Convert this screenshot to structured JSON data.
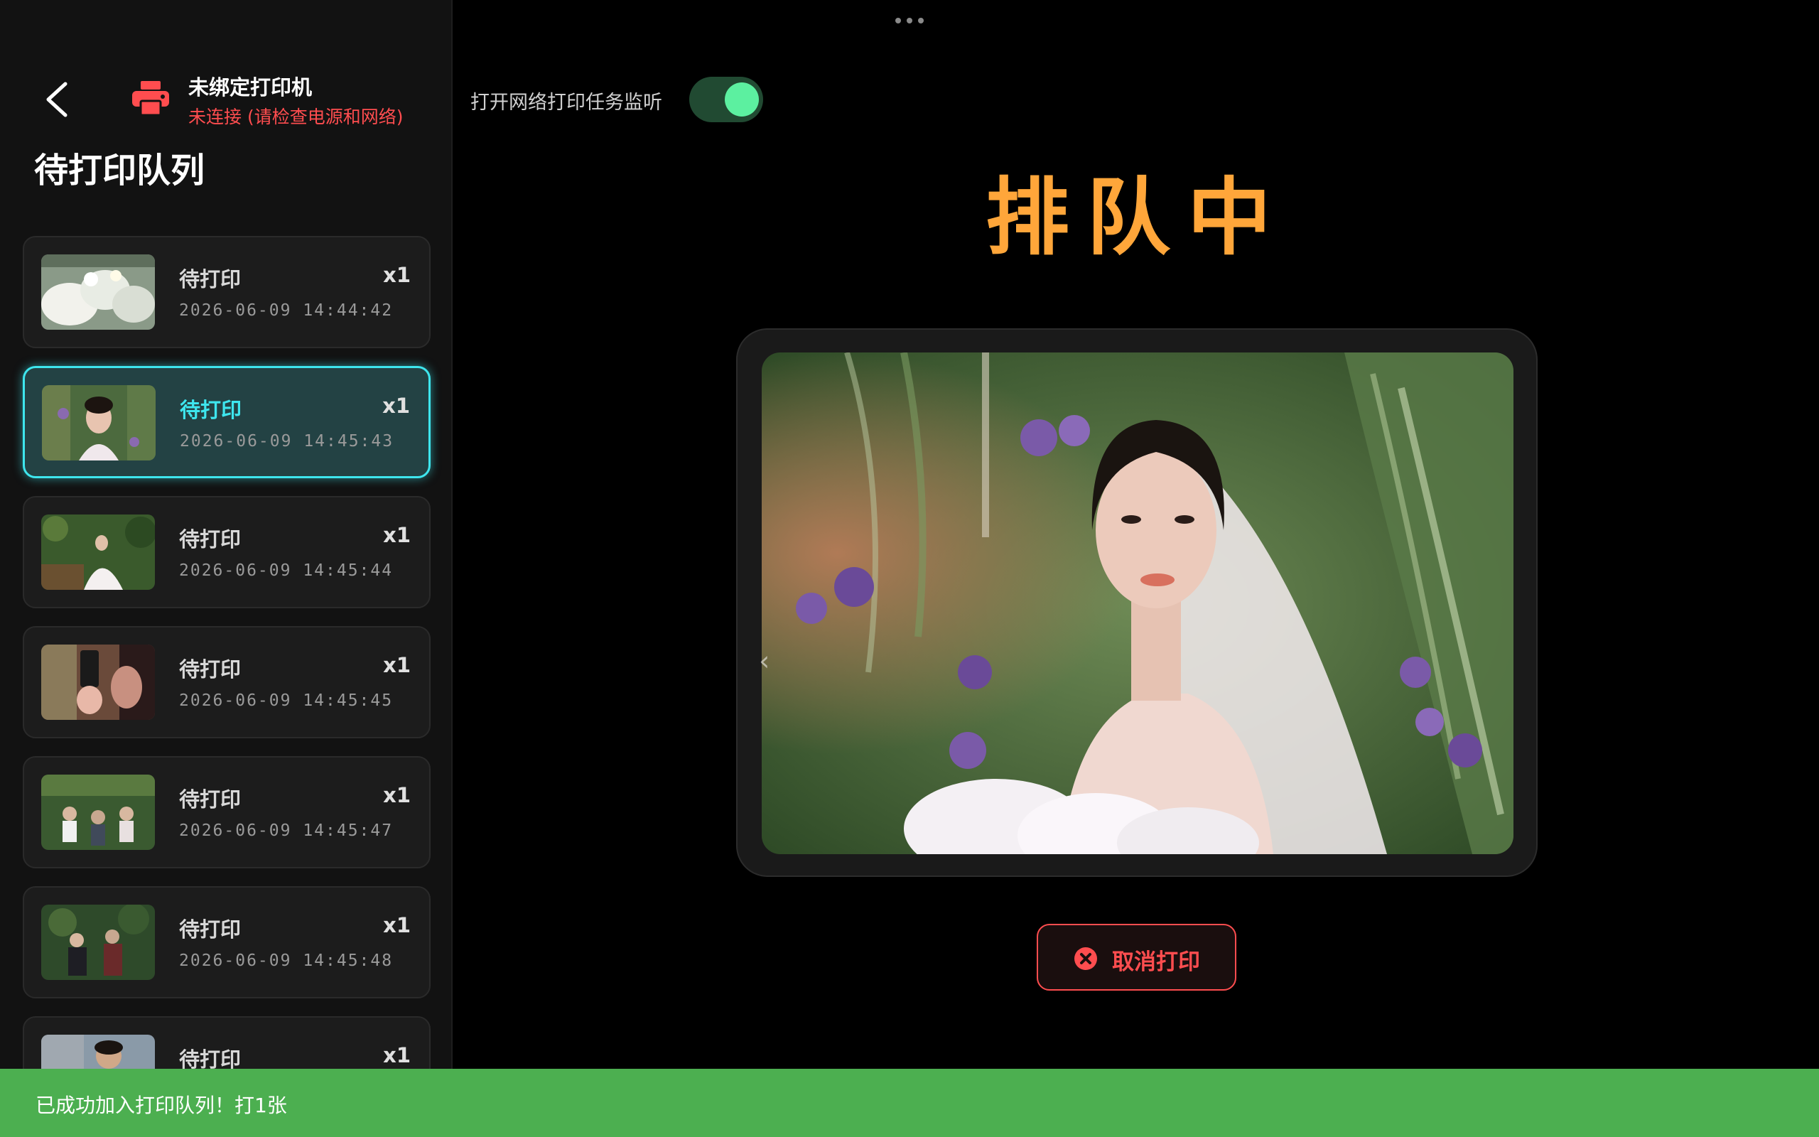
{
  "sidebar": {
    "back_icon": "chevron-left-icon",
    "printer_icon": "printer-icon",
    "printer_name": "未绑定打印机",
    "printer_status": "未连接 (请检查电源和网络)",
    "queue_title": "待打印队列",
    "status_color": "#ff4d4f",
    "selected_accent": "#3ee6ee",
    "items": [
      {
        "label": "待打印",
        "time": "2026-06-09 14:44:42",
        "count": "x1",
        "thumb": "white flowers bouquet"
      },
      {
        "label": "待打印",
        "time": "2026-06-09 14:45:43",
        "count": "x1",
        "thumb": "bride portrait",
        "selected": true
      },
      {
        "label": "待打印",
        "time": "2026-06-09 14:45:44",
        "count": "x1",
        "thumb": "bride in garden"
      },
      {
        "label": "待打印",
        "time": "2026-06-09 14:45:45",
        "count": "x1",
        "thumb": "phone photo"
      },
      {
        "label": "待打印",
        "time": "2026-06-09 14:45:47",
        "count": "x1",
        "thumb": "guests outdoors"
      },
      {
        "label": "待打印",
        "time": "2026-06-09 14:45:48",
        "count": "x1",
        "thumb": "guests seated"
      },
      {
        "label": "待打印",
        "time": "",
        "count": "x1",
        "thumb": "guest portrait"
      }
    ]
  },
  "main": {
    "menu_icon": "more-dots-icon",
    "monitor_label": "打开网络打印任务监听",
    "monitor_enabled": true,
    "status_title": "排队中",
    "status_color": "#ffa63a",
    "preview_alt": "bride with veil among purple flowers",
    "prev_icon": "chevron-left-icon",
    "cancel_label": "取消打印",
    "cancel_icon": "close-circle-icon"
  },
  "toast": {
    "message": "已成功加入打印队列！打1张",
    "color": "#4caf50"
  }
}
